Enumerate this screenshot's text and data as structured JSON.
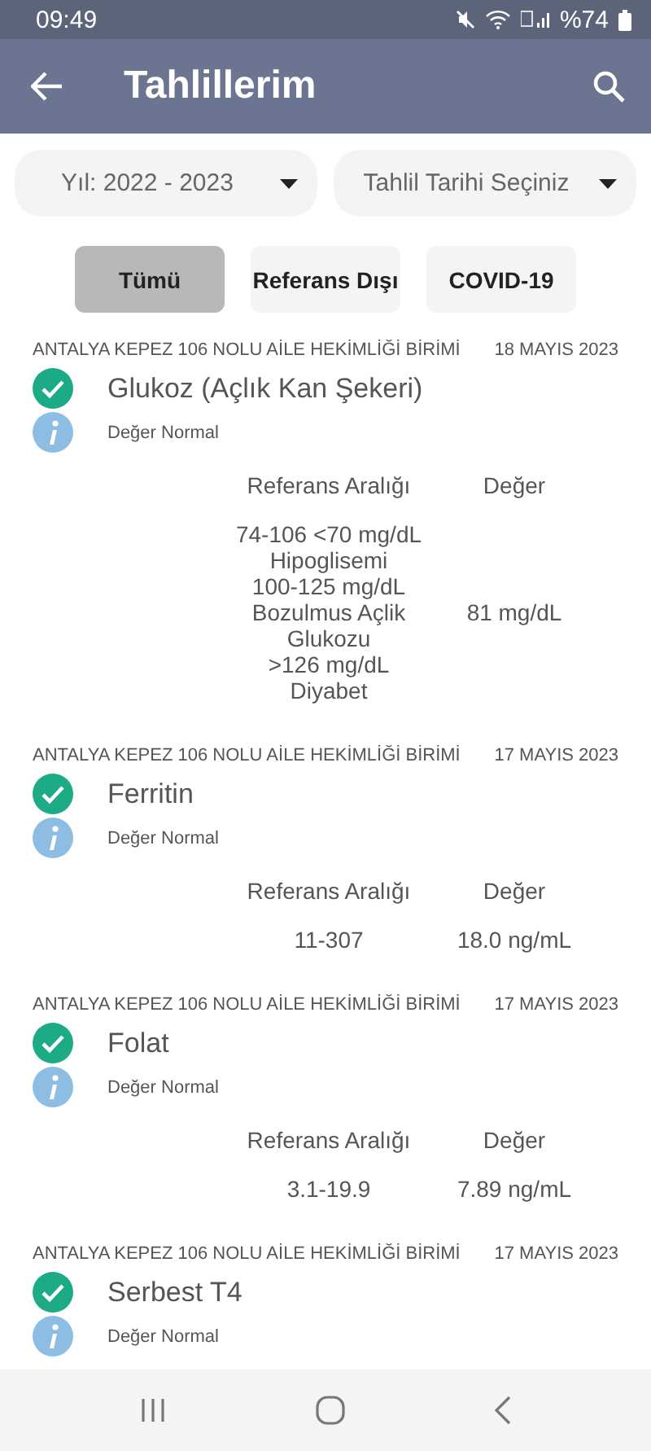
{
  "status_bar": {
    "time": "09:49",
    "battery": "%74"
  },
  "app_bar": {
    "title": "Tahlillerim"
  },
  "filters": [
    {
      "label": "Yıl: 2022 - 2023"
    },
    {
      "label": "Tahlil Tarihi Seçiniz"
    }
  ],
  "tabs": [
    {
      "label": "Tümü",
      "selected": true
    },
    {
      "label": "Referans Dışı",
      "selected": false
    },
    {
      "label": "COVID-19",
      "selected": false
    }
  ],
  "results": [
    {
      "institution": "ANTALYA KEPEZ 106 NOLU AİLE HEKİMLİĞİ BİRİMİ",
      "date": "18 MAYIS 2023",
      "test": "Glukoz (Açlık Kan Şekeri)",
      "normal": true,
      "note": "Değer Normal",
      "range_label": "Referans Aralığı",
      "value_label": "Değer",
      "range": "74-106 <70 mg/dL Hipoglisemi\n100-125 mg/dL Bozulmus Açlik Glukozu\n>126 mg/dL Diyabet",
      "value": "81 mg/dL"
    },
    {
      "institution": "ANTALYA KEPEZ 106 NOLU AİLE HEKİMLİĞİ BİRİMİ",
      "date": "17 MAYIS 2023",
      "test": "Ferritin",
      "normal": true,
      "note": "Değer Normal",
      "range_label": "Referans Aralığı",
      "value_label": "Değer",
      "range": "11-307",
      "value": "18.0 ng/mL"
    },
    {
      "institution": "ANTALYA KEPEZ 106 NOLU AİLE HEKİMLİĞİ BİRİMİ",
      "date": "17 MAYIS 2023",
      "test": "Folat",
      "normal": true,
      "note": "Değer Normal",
      "range_label": "Referans Aralığı",
      "value_label": "Değer",
      "range": "3.1-19.9",
      "value": "7.89 ng/mL"
    },
    {
      "institution": "ANTALYA KEPEZ 106 NOLU AİLE HEKİMLİĞİ BİRİMİ",
      "date": "17 MAYIS 2023",
      "test": "Serbest T4",
      "normal": true,
      "note": "Değer Normal"
    }
  ]
}
